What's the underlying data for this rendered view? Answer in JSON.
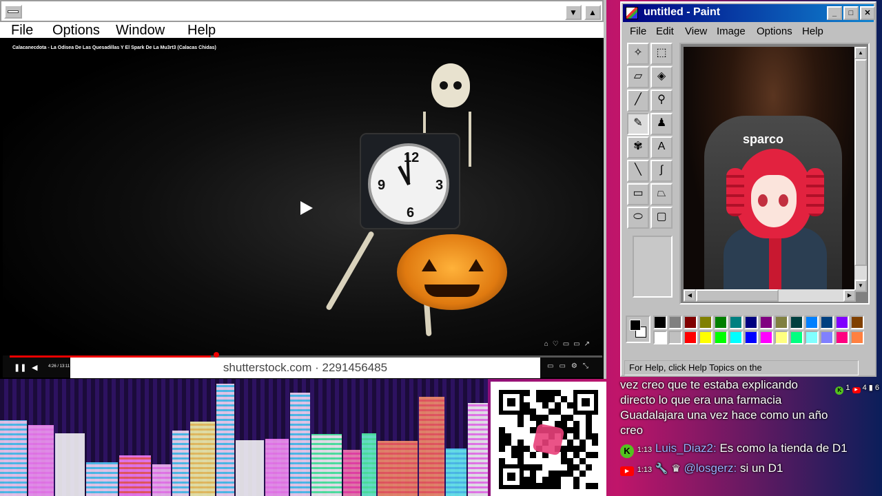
{
  "player": {
    "menu": [
      "File",
      "Options",
      "Window",
      "Help"
    ],
    "video_title": "Calacanecdota - La Odisea De Las Quesadillas Y El Spark De La Mu3rt3 (Calacas Chidas)",
    "time": "4:26 / 13:11",
    "watermark": "shutterstock.com · 2291456485",
    "progress": 0.34,
    "clock_numbers": [
      "12",
      "9",
      "3",
      "6"
    ]
  },
  "paint": {
    "title": "untitled - Paint",
    "menu": [
      "File",
      "Edit",
      "View",
      "Image",
      "Options",
      "Help"
    ],
    "status": "For Help, click Help Topics on the",
    "chair_logo": "sparco",
    "palette_top": [
      "#000000",
      "#808080",
      "#800000",
      "#808000",
      "#008000",
      "#008080",
      "#000080",
      "#800080",
      "#808040",
      "#004040",
      "#0080ff",
      "#004080",
      "#8000ff",
      "#804000"
    ],
    "palette_bottom": [
      "#ffffff",
      "#c0c0c0",
      "#ff0000",
      "#ffff00",
      "#00ff00",
      "#00ffff",
      "#0000ff",
      "#ff00ff",
      "#ffff80",
      "#00ff80",
      "#80ffff",
      "#8080ff",
      "#ff0080",
      "#ff8040"
    ]
  },
  "chat": {
    "counts": [
      "1",
      "4",
      "6"
    ],
    "messages": [
      {
        "text": "vez creo que te estaba explicando"
      },
      {
        "text": "directo lo que era una farmacia"
      },
      {
        "text": "Guadalajara una vez hace como un año"
      },
      {
        "text": "creo"
      },
      {
        "time": "1:13",
        "user": "Luis_Diaz2:",
        "text": "Es como la tienda de D1"
      },
      {
        "time": "1:13",
        "user": "@losgerz:",
        "text": "si un D1"
      }
    ]
  },
  "colors": {
    "paint_title": "#000080",
    "chat_user": "#9ab0ff",
    "progress": "#ee0000"
  }
}
